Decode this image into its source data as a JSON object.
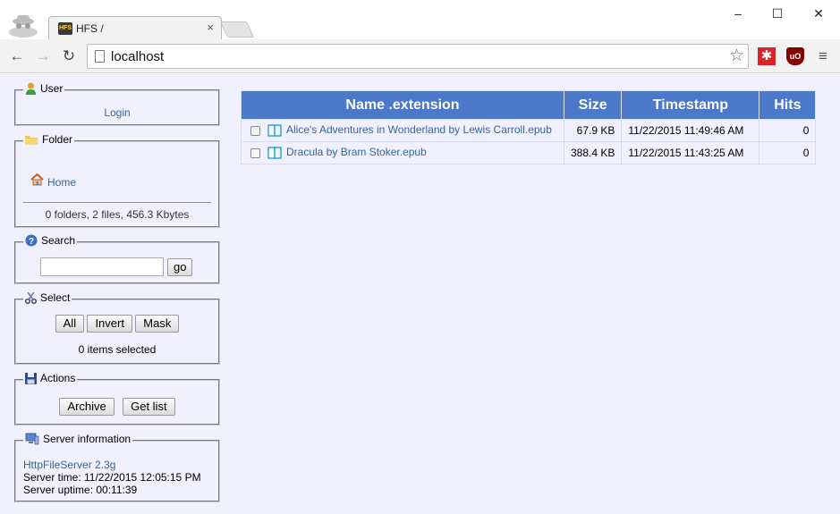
{
  "browser": {
    "tab_title": "HFS /",
    "tab_close": "×",
    "url": "localhost",
    "window_controls": {
      "minimize": "–",
      "maximize": "☐",
      "close": "✕"
    }
  },
  "sidebar": {
    "user": {
      "legend": "User",
      "login_link": "Login"
    },
    "folder": {
      "legend": "Folder",
      "home_link": "Home",
      "summary": "0 folders, 2 files, 456.3 Kbytes"
    },
    "search": {
      "legend": "Search",
      "input_value": "",
      "go_label": "go"
    },
    "select": {
      "legend": "Select",
      "all_label": "All",
      "invert_label": "Invert",
      "mask_label": "Mask",
      "status": "0 items selected"
    },
    "actions": {
      "legend": "Actions",
      "archive_label": "Archive",
      "getlist_label": "Get list"
    },
    "server": {
      "legend": "Server information",
      "software_link": "HttpFileServer 2.3g",
      "server_time": "Server time: 11/22/2015 12:05:15 PM",
      "server_uptime": "Server uptime: 00:11:39"
    }
  },
  "file_table": {
    "headers": {
      "name": "Name .extension",
      "size": "Size",
      "timestamp": "Timestamp",
      "hits": "Hits"
    },
    "rows": [
      {
        "name": "Alice's Adventures in Wonderland by Lewis Carroll.epub",
        "size": "67.9 KB",
        "timestamp": "11/22/2015 11:49:46 AM",
        "hits": "0"
      },
      {
        "name": "Dracula by Bram Stoker.epub",
        "size": "388.4 KB",
        "timestamp": "11/22/2015 11:43:25 AM",
        "hits": "0"
      }
    ]
  },
  "colors": {
    "page_background": "#f0f0ff",
    "table_header": "#4b78c7",
    "link": "#336699"
  }
}
